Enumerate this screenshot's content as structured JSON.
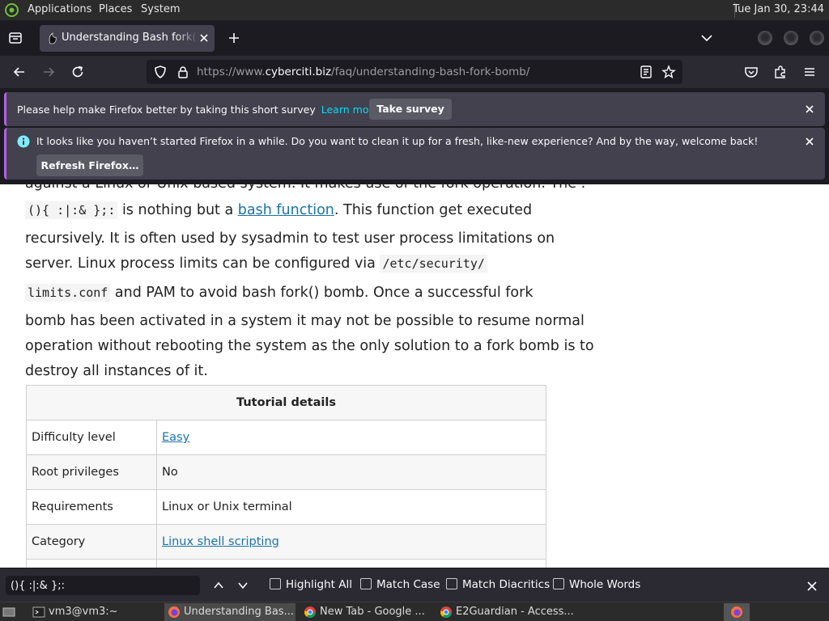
{
  "top_panel": {
    "menus": [
      "Applications",
      "Places",
      "System"
    ],
    "clock": "Tue Jan 30, 23:44"
  },
  "tabs": {
    "active_title": "Understanding Bash fork() Bomb"
  },
  "url_bar": {
    "prefix": "https://www.",
    "host": "cyberciti.biz",
    "path": "/faq/understanding-bash-fork-bomb/"
  },
  "notifications": {
    "survey": {
      "text": "Please help make Firefox better by taking this short survey",
      "link": "Learn more",
      "button": "Take survey"
    },
    "refresh": {
      "text": "It looks like you haven’t started Firefox in a while. Do you want to clean it up for a fresh, like-new experience? And by the way, welcome back!",
      "button": "Refresh Firefox…"
    }
  },
  "article": {
    "cutoff": "against a Linux or Unix based system. It makes use of the fork operation. The :",
    "code_fork": "(){ :|:& };:",
    "t1": " is nothing but a ",
    "link_bash_function": "bash function",
    "t2": ". This function get executed",
    "line3": "recursively. It is often used by sysadmin to test user process limitations on",
    "t4": "server. Linux process limits can be configured via ",
    "code_path1": "/etc/security/",
    "code_path2": "limits.conf",
    "t5": " and PAM to avoid bash fork() bomb. Once a successful fork",
    "line6": "bomb has been activated in a system it may not be possible to resume normal",
    "line7": "operation without rebooting the system as the only solution to a fork bomb is to",
    "line8": "destroy all instances of it."
  },
  "tutorial_table": {
    "header": "Tutorial details",
    "rows": [
      {
        "label": "Difficulty level",
        "value": "Easy"
      },
      {
        "label": "Root privileges",
        "value": "No"
      },
      {
        "label": "Requirements",
        "value": "Linux or Unix terminal"
      },
      {
        "label": "Category",
        "value": "Linux shell scripting"
      }
    ]
  },
  "find_bar": {
    "query": "(){ :|:& };:",
    "options": [
      "Highlight All",
      "Match Case",
      "Match Diacritics",
      "Whole Words"
    ]
  },
  "taskbar": {
    "tasks": [
      "vm3@vm3:~",
      "Understanding Bas...",
      "New Tab - Google ...",
      "E2Guardian - Access..."
    ]
  },
  "colors": {
    "firefox_dark": "#1c1b22",
    "toolbar": "#2b2a33",
    "notification": "#42414d",
    "link": "#1a73a8",
    "accent_cyan": "#00ddff"
  }
}
